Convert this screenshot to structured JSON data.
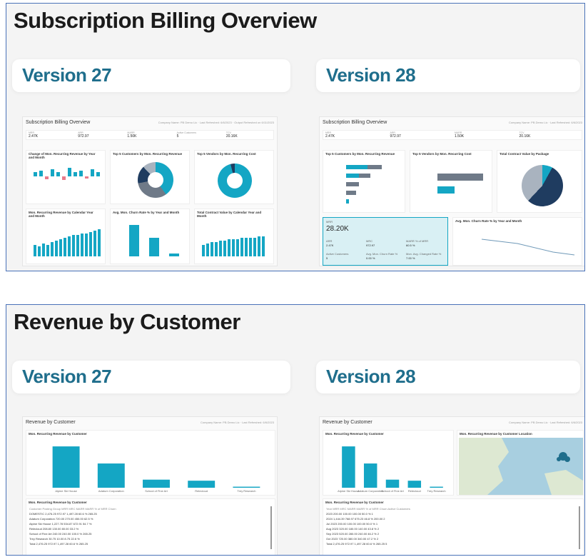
{
  "sections": [
    {
      "title": "Subscription Billing Overview",
      "left_version": "Version 27",
      "right_version": "Version 28",
      "left_report": {
        "header": "Subscription Billing Overview",
        "meta": "Company Name: PB Demo Lic · Last Refreshed: 6/6/2023 · Output Refreshed on 6/11/2023",
        "kpis": [
          {
            "k": "MRR",
            "v": "2.47K"
          },
          {
            "k": "ARR",
            "v": "972.97"
          },
          {
            "k": "MARR",
            "v": "1.50K"
          },
          {
            "k": "Active Customers",
            "v": "5"
          },
          {
            "k": "TCV",
            "v": "20.16K"
          }
        ],
        "tiles": [
          "Change of Mon. Recurring Revenue by Year and Month",
          "Top 5 Customers by Mon. Recurring Revenue",
          "Top 5 Vendors by Mon. Recurring Cost",
          "Mon. Recurring Revenue by Calendar Year and Month",
          "Avg. Mon. Churn Rate % by Year and Month",
          "Total Contract Value by Calendar Year and Month"
        ]
      },
      "right_report": {
        "header": "Subscription Billing Overview",
        "meta": "Company Name: PB Demo Lic · Last Refreshed: 6/6/2023",
        "kpis": [
          {
            "k": "MRR",
            "v": "2.47K"
          },
          {
            "k": "ARR",
            "v": "972.97"
          },
          {
            "k": "MARR",
            "v": "1.50K"
          },
          {
            "k": "TCV",
            "v": "20.16K"
          }
        ],
        "tiles": [
          "Top 5 Customers by Mon. Recurring Revenue",
          "Top 5 Vendors by Mon. Recurring Cost",
          "Total Contract Value by Package",
          "Avg. Mon. Churn Rate % by Year and Month"
        ],
        "highlight": {
          "label": "MRR",
          "value": "28.20K",
          "items": [
            {
              "k": "ARR",
              "v": "2.47K"
            },
            {
              "k": "MRC",
              "v": "972.97"
            },
            {
              "k": "MARR % of MRR",
              "v": "60.5 %"
            },
            {
              "k": "Active Customers",
              "v": "5"
            },
            {
              "k": "Avg. Mon. Churn Rate %",
              "v": "0.00 %"
            },
            {
              "k": "Mon. Avg. Changed Rate %",
              "v": "7.00 %"
            }
          ]
        }
      }
    },
    {
      "title": "Revenue by Customer",
      "left_version": "Version 27",
      "right_version": "Version 28",
      "left_report": {
        "header": "Revenue by Customer",
        "meta": "Company Name: PB Demo Lic · Last Refreshed: 6/6/2023",
        "chart_title": "Mon. Recurring Revenue by Customer",
        "table_title": "Mon. Recurring Revenue by Customer",
        "columns": [
          "Customer Posting Group",
          "MRR",
          "MRC",
          "MARR",
          "MARR % of MRR",
          "Churn"
        ],
        "rows": [
          [
            "DOMESTIC",
            "2,476.25",
            "972.97",
            "1,497.28",
            "60.6 %",
            "265.25"
          ],
          [
            "Adatum Corporation",
            "720.00",
            "270.00",
            "450.00",
            "62.5 %",
            ""
          ],
          [
            "Alpine Ski House",
            "1,227.78",
            "534.87",
            "672.91",
            "54.7 %",
            ""
          ],
          [
            "Relecloud",
            "208.80",
            "130.00",
            "80.00",
            "33.2 %",
            ""
          ],
          [
            "School of Fine Art",
            "240.00",
            "",
            "240.00",
            "100.0 %",
            "265.25"
          ],
          [
            "Trey Research",
            "30.75",
            "10.00",
            "8.75",
            "22.6 %",
            ""
          ],
          [
            "Total",
            "2,476.25",
            "972.97",
            "1,497.28",
            "60.6 %",
            "265.25"
          ]
        ]
      },
      "right_report": {
        "header": "Revenue by Customer",
        "meta": "Company Name: PB Demo Lic · Last Refreshed: 6/6/2023",
        "chart_title": "Mon. Recurring Revenue by Customer",
        "map_title": "Mon. Recurring Revenue by Customer Location",
        "table_title": "Mon. Recurring Revenue by Customer",
        "columns": [
          "Year",
          "MRR",
          "MRC",
          "MARR",
          "MARR % of MRR",
          "Churn",
          "Active Customers"
        ],
        "rows": [
          [
            "2023",
            "200.00",
            "100.00",
            "100.00",
            "50.0 %",
            "",
            "1"
          ],
          [
            "2024",
            "1,444.39",
            "768.97",
            "675.23",
            "46.8 %",
            "200.00",
            "2"
          ],
          [
            "Jul 2023",
            "200.00",
            "100.00",
            "100.00",
            "50.0 %",
            "",
            "1"
          ],
          [
            "Aug 2023",
            "320.00",
            "180.00",
            "140.00",
            "43.8 %",
            "",
            "2"
          ],
          [
            "Sep 2023",
            "520.00",
            "280.00",
            "240.00",
            "46.2 %",
            "",
            "2"
          ],
          [
            "Oct 2023",
            "720.00",
            "380.00",
            "340.00",
            "47.2 %",
            "",
            "2"
          ],
          [
            "Total",
            "2,476.25",
            "972.97",
            "1,497.28",
            "60.6 %",
            "265.25",
            "5"
          ]
        ]
      }
    }
  ],
  "chart_data": [
    {
      "type": "bar",
      "title": "Mon. Recurring Revenue by Customer",
      "categories": [
        "Alpine Ski House",
        "Adatum Corporation",
        "School of Fine Art",
        "Relecloud",
        "Trey Research"
      ],
      "values": [
        1227.78,
        720.0,
        240.0,
        208.8,
        30.75
      ],
      "ylim": [
        0,
        1400
      ]
    }
  ]
}
